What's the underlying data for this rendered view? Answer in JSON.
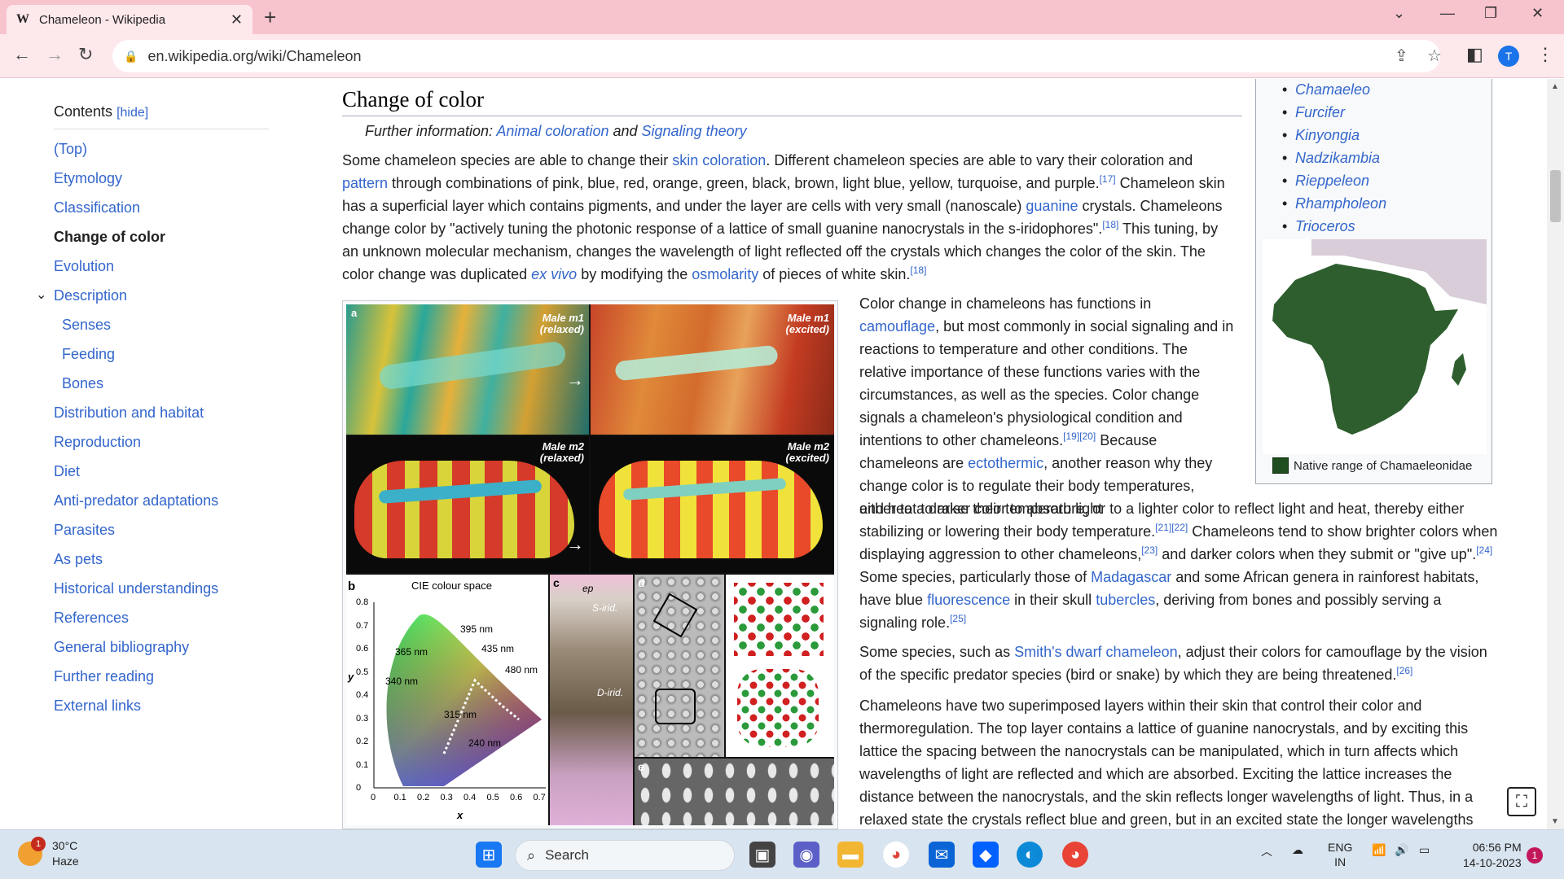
{
  "browser": {
    "tab_title": "Chameleon - Wikipedia",
    "tab_icon": "W",
    "new_tab": "+",
    "url": "en.wikipedia.org/wiki/Chameleon",
    "profile_initial": "T"
  },
  "toc": {
    "title": "Contents",
    "hide_label": "[hide]",
    "items": [
      {
        "label": "(Top)"
      },
      {
        "label": "Etymology"
      },
      {
        "label": "Classification"
      },
      {
        "label": "Change of color",
        "active": true
      },
      {
        "label": "Evolution"
      },
      {
        "label": "Description"
      },
      {
        "label": "Senses",
        "sub": true
      },
      {
        "label": "Feeding",
        "sub": true
      },
      {
        "label": "Bones",
        "sub": true
      },
      {
        "label": "Distribution and habitat"
      },
      {
        "label": "Reproduction"
      },
      {
        "label": "Diet"
      },
      {
        "label": "Anti-predator adaptations"
      },
      {
        "label": "Parasites"
      },
      {
        "label": "As pets"
      },
      {
        "label": "Historical understandings"
      },
      {
        "label": "References"
      },
      {
        "label": "General bibliography"
      },
      {
        "label": "Further reading"
      },
      {
        "label": "External links"
      }
    ]
  },
  "article": {
    "section_title": "Change of color",
    "hatnote": {
      "prefix": "Further information: ",
      "link1": "Animal coloration",
      "and": " and ",
      "link2": "Signaling theory"
    },
    "p1": {
      "t1": "Some chameleon species are able to change their ",
      "l1": "skin coloration",
      "t2": ". Different chameleon species are able to vary their coloration and ",
      "l2": "pattern",
      "t3": " through combinations of pink, blue, red, orange, green, black, brown, light blue, yellow, turquoise, and purple.",
      "r1": "[17]",
      "t4": " Chameleon skin has a superficial layer which contains pigments, and under the layer are cells with very small (nanoscale) ",
      "l3": "guanine",
      "t5": " crystals. Chameleons change color by \"actively tuning the photonic response of a lattice of small guanine nanocrystals in the s-iridophores\".",
      "r2": "[18]",
      "t6": " This tuning, by an unknown molecular mechanism, changes the wavelength of light reflected off the crystals which changes the color of the skin. The color change was duplicated ",
      "l4": "ex vivo",
      "t7": " by modifying the ",
      "l5": "osmolarity",
      "t8": " of pieces of white skin.",
      "r3": "[18]"
    },
    "p2": {
      "t1": "Color change in chameleons has functions in ",
      "l1": "camouflage",
      "t2": ", but most commonly in social signaling and in reactions to temperature and other conditions. The relative importance of these functions varies with the circumstances, as well as the species. Color change signals a chameleon's physiological condition and intentions to other chameleons.",
      "r1": "[19][20]",
      "t3": " Because chameleons are ",
      "l2": "ectothermic",
      "t4": ", another reason why they change color is to regulate their body temperatures, either to a darker color to absorb light",
      "t5": "and heat to raise their temperature, or to a lighter color to reflect light and heat, thereby either stabilizing or lowering their body temperature.",
      "r2": "[21][22]",
      "t6": " Chameleons tend to show brighter colors when displaying aggression to other chameleons,",
      "r3": "[23]",
      "t7": " and darker colors when they submit or \"give up\".",
      "r4": "[24]",
      "t8": " Some species, particularly those of ",
      "l3": "Madagascar",
      "t9": " and some African genera in rainforest habitats, have blue ",
      "l4": "fluorescence",
      "t10": " in their skull ",
      "l5": "tubercles",
      "t11": ", deriving from bones and possibly serving a signaling role.",
      "r5": "[25]"
    },
    "p3": {
      "t1": "Some species, such as ",
      "l1": "Smith's dwarf chameleon",
      "t2": ", adjust their colors for camouflage by the vision of the specific predator species (bird or snake) by which they are being threatened.",
      "r1": "[26]"
    },
    "p4": {
      "t1": "Chameleons have two superimposed layers within their skin that control their color and thermoregulation. The top layer contains a lattice of guanine nanocrystals, and by exciting this lattice the spacing between the nanocrystals can be manipulated, which in turn affects which wavelengths of light are reflected and which are absorbed. Exciting the lattice increases the distance between the nanocrystals, and the skin reflects longer wavelengths of light. Thus, in a relaxed state the crystals reflect blue and green, but in an excited state the longer wavelengths such as yellow, orange, green,"
    }
  },
  "figure": {
    "label_a": "a",
    "m1_relaxed": [
      "Male m1",
      "(relaxed)"
    ],
    "m1_excited": [
      "Male m1",
      "(excited)"
    ],
    "m2_relaxed": [
      "Male m2",
      "(relaxed)"
    ],
    "m2_excited": [
      "Male m2",
      "(excited)"
    ],
    "label_b": "b",
    "cie_title": "CIE colour space",
    "wavelengths": [
      "395 nm",
      "435 nm",
      "365 nm",
      "480 nm",
      "340 nm",
      "315 nm",
      "240 nm"
    ],
    "y_axis": "y",
    "x_axis": "x",
    "y_ticks": [
      "0.8",
      "0.7",
      "0.6",
      "0.5",
      "0.4",
      "0.3",
      "0.2",
      "0.1",
      "0"
    ],
    "x_ticks": [
      "0",
      "0.1",
      "0.2",
      "0.3",
      "0.4",
      "0.5",
      "0.6",
      "0.7"
    ],
    "label_c": "c",
    "label_ep": "ep",
    "label_sirid": "S-irid.",
    "label_dirid": "D-irid.",
    "label_d": "d",
    "label_e": "e"
  },
  "infobox": {
    "genera": [
      "Chamaeleo",
      "Furcifer",
      "Kinyongia",
      "Nadzikambia",
      "Rieppeleon",
      "Rhampholeon",
      "Trioceros"
    ],
    "map_legend": "Native range of Chamaeleonidae",
    "map_color": "#2e5e2e"
  },
  "taskbar": {
    "temp": "30°C",
    "weather": "Haze",
    "weather_badge": "1",
    "search_placeholder": "Search",
    "lang1": "ENG",
    "lang2": "IN",
    "time": "06:56 PM",
    "date": "14-10-2023",
    "notif_count": "1"
  }
}
